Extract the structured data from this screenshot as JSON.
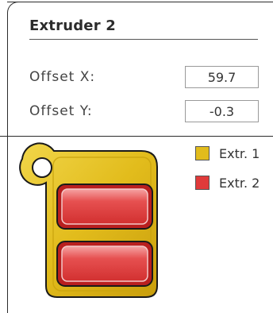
{
  "panel": {
    "title": "Extruder 2"
  },
  "offsets": {
    "x_label": "Offset X:",
    "x_value": "59.7",
    "y_label": "Offset Y:",
    "y_value": "-0.3"
  },
  "legend": {
    "items": [
      {
        "label": "Extr. 1",
        "color": "#e2bc1c"
      },
      {
        "label": "Extr. 2",
        "color": "#e03a3a"
      }
    ]
  },
  "colors": {
    "frame": "#2b2b2b",
    "holder_gold": "#e2bc1c",
    "nozzle_red": "#e03a3a"
  },
  "icons": {
    "holder": "extruder-holder-icon"
  }
}
